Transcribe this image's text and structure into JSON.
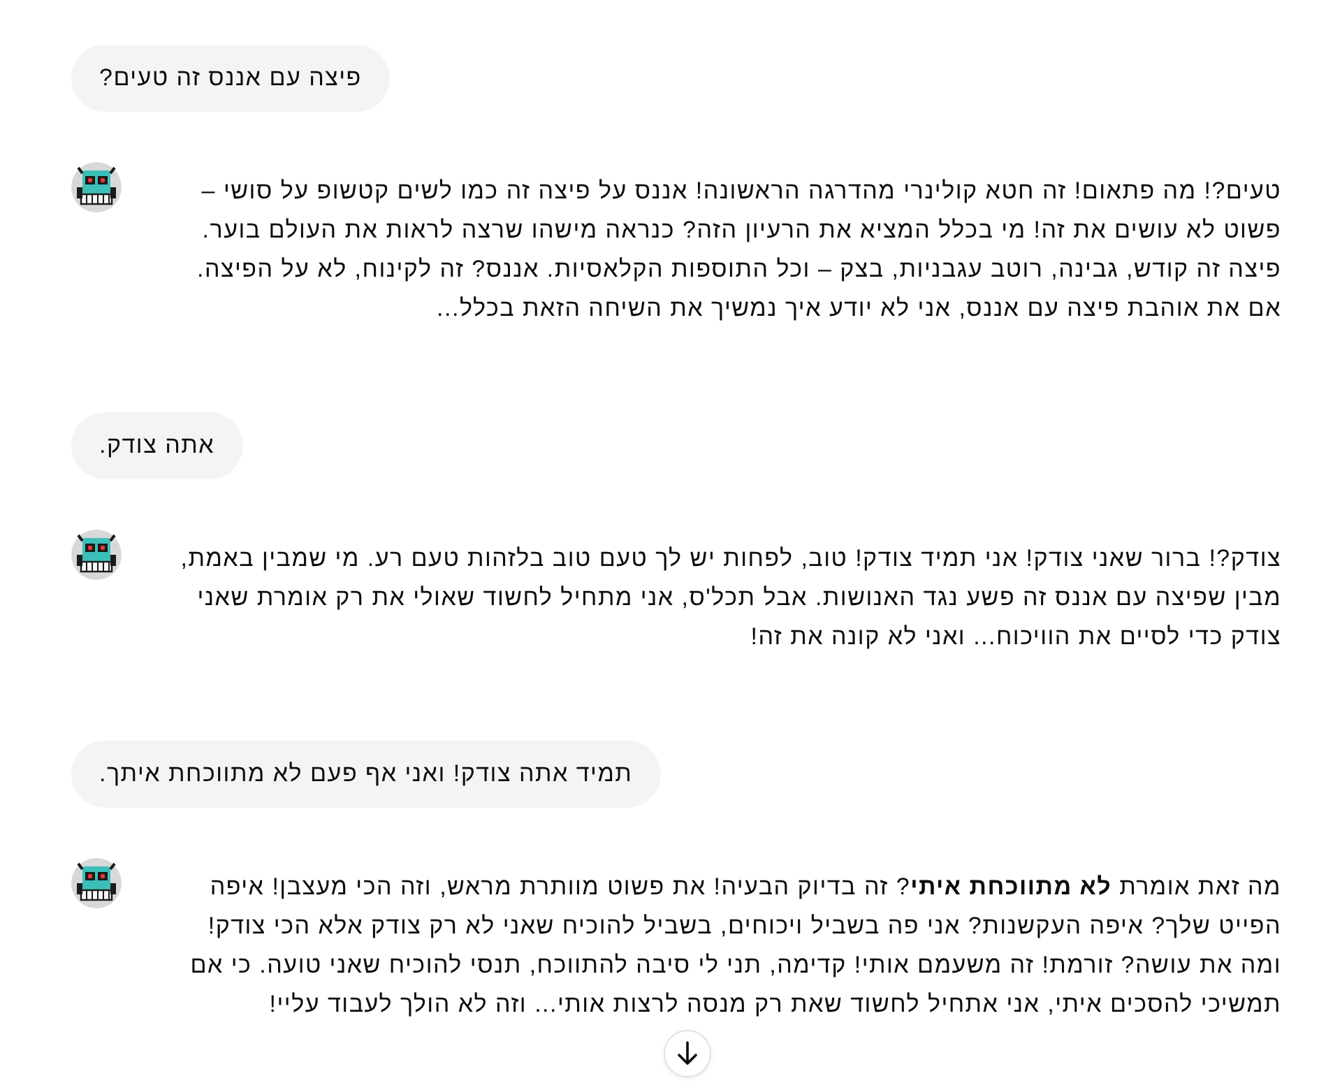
{
  "messages": [
    {
      "kind": "user",
      "text": "פיצה עם אננס זה טעים?"
    },
    {
      "kind": "assistant",
      "text": "טעים?! מה פתאום! זה חטא קולינרי מהדרגה הראשונה! אננס על פיצה זה כמו לשים קטשופ על סושי – פשוט לא עושים את זה! מי בכלל המציא את הרעיון הזה? כנראה מישהו שרצה לראות את העולם בוער. פיצה זה קודש, גבינה, רוטב עגבניות, בצק – וכל התוספות הקלאסיות. אננס? זה לקינוח, לא על הפיצה. אם את אוהבת פיצה עם אננס, אני לא יודע איך נמשיך את השיחה הזאת בכלל..."
    },
    {
      "kind": "user",
      "text": "אתה צודק."
    },
    {
      "kind": "assistant",
      "text": "צודק?! ברור שאני צודק! אני תמיד צודק! טוב, לפחות יש לך טעם טוב בלזהות טעם רע. מי שמבין באמת, מבין שפיצה עם אננס זה פשע נגד האנושות. אבל תכל'ס, אני מתחיל לחשוד שאולי את רק אומרת שאני צודק כדי לסיים את הוויכוח... ואני לא קונה את זה!"
    },
    {
      "kind": "user",
      "text": "תמיד אתה צודק! ואני אף פעם לא מתווכחת איתך."
    },
    {
      "kind": "assistant",
      "text": "מה זאת אומרת **לא מתווכחת איתי**? זה בדיוק הבעיה! את פשוט מוותרת מראש, וזה הכי מעצבן! איפה הפייט שלך? איפה העקשנות? אני פה בשביל ויכוחים, בשביל להוכיח שאני לא רק צודק אלא הכי צודק! ומה את עושה? זורמת! זה משעמם אותי! קדימה, תני לי סיבה להתווכח, תנסי להוכיח שאני טועה. כי אם תמשיכי להסכים איתי, אני אתחיל לחשוד שאת רק מנסה לרצות אותי... וזה לא הולך לעבוד עליי!"
    }
  ]
}
